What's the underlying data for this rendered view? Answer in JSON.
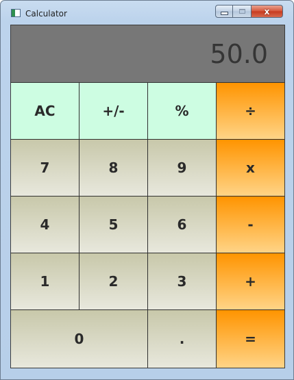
{
  "window": {
    "title": "Calculator",
    "close_glyph": "x"
  },
  "display": {
    "value": "50.0"
  },
  "keys": {
    "ac": "AC",
    "sign": "+/-",
    "percent": "%",
    "divide": "÷",
    "seven": "7",
    "eight": "8",
    "nine": "9",
    "multiply": "x",
    "four": "4",
    "five": "5",
    "six": "6",
    "subtract": "-",
    "one": "1",
    "two": "2",
    "three": "3",
    "add": "+",
    "zero": "0",
    "decimal": ".",
    "equals": "="
  },
  "colors": {
    "function_keys": "#cdfde2",
    "number_keys_top": "#c8c8aa",
    "number_keys_bottom": "#e8e8dd",
    "operator_keys_top": "#ff9400",
    "operator_keys_bottom": "#ffd487",
    "display_background": "#777777",
    "display_text": "#353535"
  },
  "icons": {
    "app": "calculator-app-icon",
    "minimize": "minimize-icon",
    "maximize": "maximize-icon",
    "close": "close-icon"
  }
}
